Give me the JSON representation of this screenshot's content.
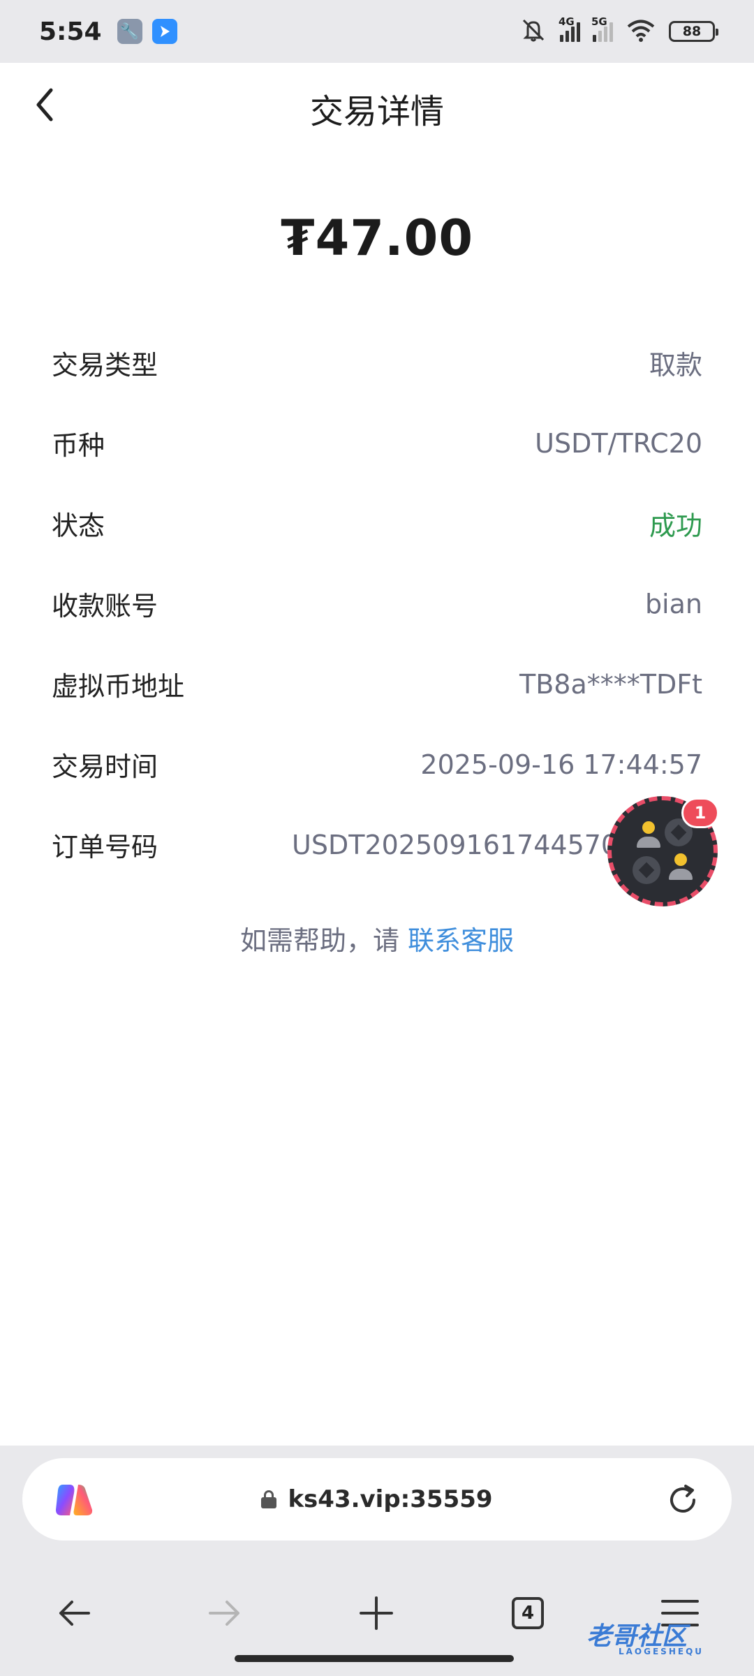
{
  "status_bar": {
    "time": "5:54",
    "network_1": "4G",
    "network_2": "5G",
    "battery": "88"
  },
  "header": {
    "title": "交易详情"
  },
  "amount": "₮47.00",
  "details": [
    {
      "label": "交易类型",
      "value": "取款"
    },
    {
      "label": "币种",
      "value": "USDT/TRC20"
    },
    {
      "label": "状态",
      "value": "成功"
    },
    {
      "label": "收款账号",
      "value": "bian"
    },
    {
      "label": "虚拟币地址",
      "value": "TB8a****TDFt"
    },
    {
      "label": "交易时间",
      "value": "2025-09-16 17:44:57"
    },
    {
      "label": "订单号码",
      "value": "USDT20250916174457005347"
    }
  ],
  "help": {
    "text": "如需帮助，请 ",
    "link": "联系客服"
  },
  "floating_widget": {
    "badge": "1"
  },
  "browser": {
    "url": "ks43.vip:35559",
    "tab_count": "4"
  },
  "watermark": {
    "text": "老哥社区",
    "sub": "LAOGESHEQU"
  },
  "colors": {
    "success": "#2e9a4f",
    "link": "#3f8edc",
    "badge": "#ee4c5a"
  }
}
